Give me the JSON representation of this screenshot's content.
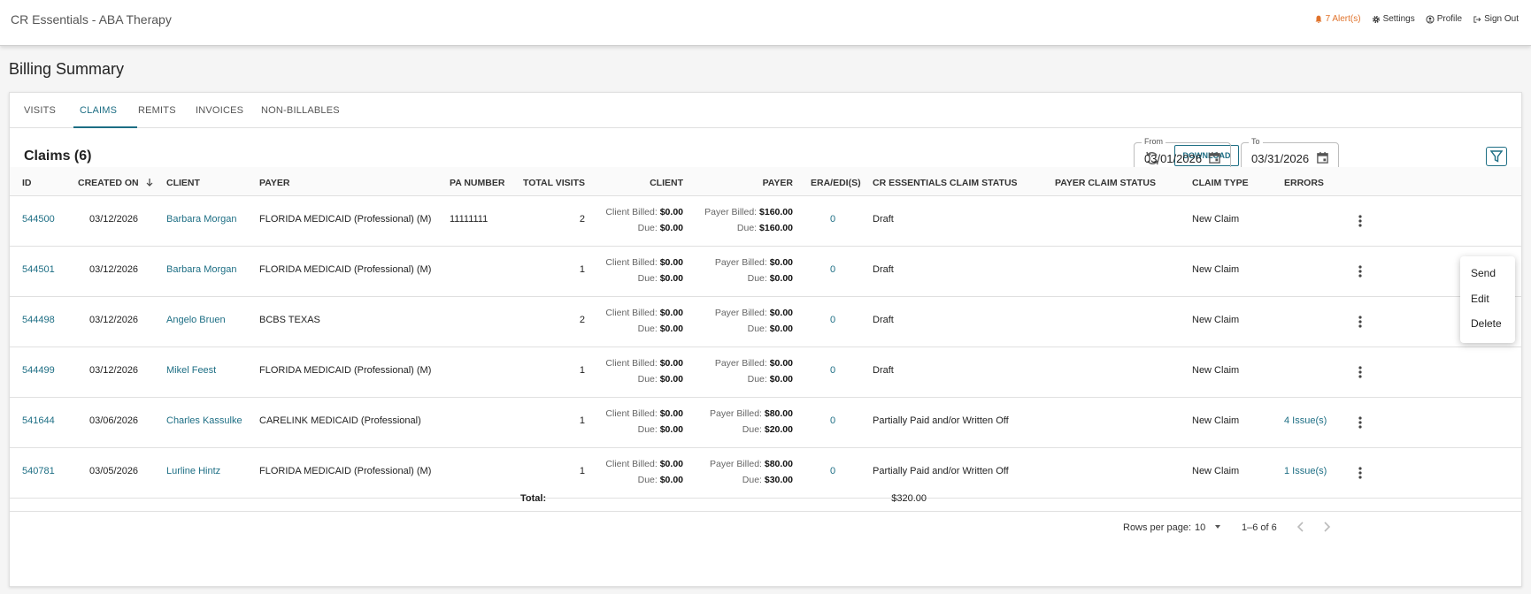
{
  "app": {
    "title": "CR Essentials - ABA Therapy"
  },
  "topnav": {
    "alerts_label": "7 Alert(s)",
    "settings_label": "Settings",
    "profile_label": "Profile",
    "signout_label": "Sign Out",
    "alert_color": "#e0732c"
  },
  "page": {
    "title": "Billing Summary"
  },
  "tabs": [
    {
      "label": "VISITS"
    },
    {
      "label": "CLAIMS",
      "active": true
    },
    {
      "label": "REMITS"
    },
    {
      "label": "INVOICES"
    },
    {
      "label": "NON-BILLABLES"
    }
  ],
  "toolbar": {
    "title": "Claims (6)",
    "download_label": "DOWNLOAD",
    "from_label": "From",
    "from_value": "03/01/2026",
    "to_label": "To",
    "to_value": "03/31/2026"
  },
  "columns": {
    "id": "ID",
    "created_on": "CREATED ON",
    "client": "CLIENT",
    "payer": "PAYER",
    "pa_number": "PA NUMBER",
    "total_visits": "TOTAL VISITS",
    "client_amt": "CLIENT",
    "payer_amt": "PAYER",
    "era": "ERA/EDI(S)",
    "cr_status": "CR ESSENTIALS CLAIM STATUS",
    "payer_status": "PAYER CLAIM STATUS",
    "claim_type": "CLAIM TYPE",
    "errors": "ERRORS"
  },
  "labels": {
    "client_billed": "Client Billed:",
    "payer_billed": "Payer Billed:",
    "due": "Due:"
  },
  "rows": [
    {
      "id": "544500",
      "created": "03/12/2026",
      "client": "Barbara Morgan",
      "payer": "FLORIDA MEDICAID (Professional) (M)",
      "pa": "11111111",
      "visits": "2",
      "client_billed": "$0.00",
      "client_due": "$0.00",
      "payer_billed": "$160.00",
      "payer_due": "$160.00",
      "era": "0",
      "status": "Draft",
      "payer_status": "",
      "type": "New Claim",
      "errors": ""
    },
    {
      "id": "544501",
      "created": "03/12/2026",
      "client": "Barbara Morgan",
      "payer": "FLORIDA MEDICAID (Professional) (M)",
      "pa": "",
      "visits": "1",
      "client_billed": "$0.00",
      "client_due": "$0.00",
      "payer_billed": "$0.00",
      "payer_due": "$0.00",
      "era": "0",
      "status": "Draft",
      "payer_status": "",
      "type": "New Claim",
      "errors": ""
    },
    {
      "id": "544498",
      "created": "03/12/2026",
      "client": "Angelo Bruen",
      "payer": "BCBS TEXAS",
      "pa": "",
      "visits": "2",
      "client_billed": "$0.00",
      "client_due": "$0.00",
      "payer_billed": "$0.00",
      "payer_due": "$0.00",
      "era": "0",
      "status": "Draft",
      "payer_status": "",
      "type": "New Claim",
      "errors": ""
    },
    {
      "id": "544499",
      "created": "03/12/2026",
      "client": "Mikel Feest",
      "payer": "FLORIDA MEDICAID (Professional) (M)",
      "pa": "",
      "visits": "1",
      "client_billed": "$0.00",
      "client_due": "$0.00",
      "payer_billed": "$0.00",
      "payer_due": "$0.00",
      "era": "0",
      "status": "Draft",
      "payer_status": "",
      "type": "New Claim",
      "errors": ""
    },
    {
      "id": "541644",
      "created": "03/06/2026",
      "client": "Charles Kassulke",
      "payer": "CARELINK MEDICAID (Professional)",
      "pa": "",
      "visits": "1",
      "client_billed": "$0.00",
      "client_due": "$0.00",
      "payer_billed": "$80.00",
      "payer_due": "$20.00",
      "era": "0",
      "status": "Partially Paid and/or Written Off",
      "payer_status": "",
      "type": "New Claim",
      "errors": "4 Issue(s)"
    },
    {
      "id": "540781",
      "created": "03/05/2026",
      "client": "Lurline Hintz",
      "payer": "FLORIDA MEDICAID (Professional) (M)",
      "pa": "",
      "visits": "1",
      "client_billed": "$0.00",
      "client_due": "$0.00",
      "payer_billed": "$80.00",
      "payer_due": "$30.00",
      "era": "0",
      "status": "Partially Paid and/or Written Off",
      "payer_status": "",
      "type": "New Claim",
      "errors": "1 Issue(s)"
    }
  ],
  "totals": {
    "label": "Total:",
    "payer_total": "$320.00"
  },
  "pagination": {
    "rows_per_page_label": "Rows per page:",
    "rows_per_page": "10",
    "range": "1–6 of 6"
  },
  "context_menu": {
    "items": [
      "Send",
      "Edit",
      "Delete"
    ],
    "highlighted": "Send",
    "highlight_color": "#fbf42d"
  },
  "theme": {
    "accent": "#1d6e84"
  }
}
